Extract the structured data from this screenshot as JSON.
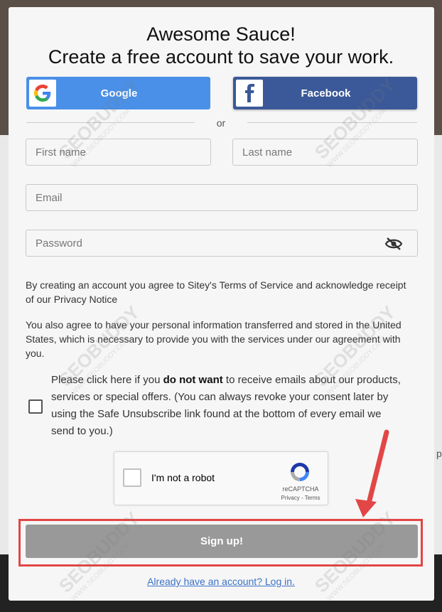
{
  "modal": {
    "title_line1": "Awesome Sauce!",
    "title_line2": "Create a free account to save your work."
  },
  "social": {
    "google_label": "Google",
    "facebook_label": "Facebook",
    "or_text": "or",
    "google_color": "#4a90e8",
    "facebook_color": "#3b5998"
  },
  "form": {
    "first_name_placeholder": "First name",
    "last_name_placeholder": "Last name",
    "email_placeholder": "Email",
    "password_placeholder": "Password"
  },
  "legal": {
    "terms_text": "By creating an account you agree to Sitey's Terms of Service and acknowledge receipt of our Privacy Notice",
    "transfer_text": "You also agree to have your personal information transferred and stored in the United States, which is necessary to provide you with the services under our agreement with you."
  },
  "optout": {
    "prefix": "Please click here if you ",
    "bold": "do not want",
    "suffix": " to receive emails about our products, services or special offers. (You can always revoke your consent later by using the Safe Unsubscribe link found at the bottom of every email we send to you.)"
  },
  "recaptcha": {
    "label": "I'm not a robot",
    "brand": "reCAPTCHA",
    "links": "Privacy - Terms"
  },
  "signup_label": "Sign up!",
  "login_link": "Already have an account? Log in.",
  "watermark": {
    "brand": "SEOBUDDY",
    "url": "WWW.SEOBUDDY.COM"
  },
  "background_glyph": "p",
  "colors": {
    "highlight": "#e24646",
    "signup_button": "#999999",
    "link": "#3b72c9"
  }
}
